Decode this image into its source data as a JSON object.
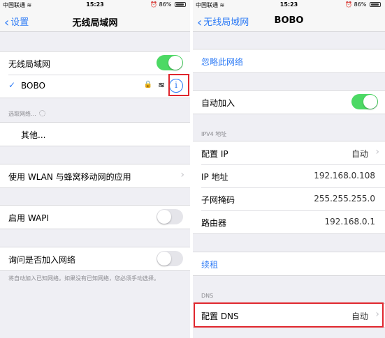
{
  "status": {
    "carrier": "中国联通",
    "time": "15:23",
    "battery": "86%"
  },
  "left": {
    "nav": {
      "back": "设置",
      "title": "无线局域网"
    },
    "wlan_label": "无线局域网",
    "network_name": "BOBO",
    "choose_network": "选取网络...",
    "other": "其他...",
    "apps": "使用 WLAN 与蜂窝移动网的应用",
    "wapi": "启用 WAPI",
    "ask_join": "询问是否加入网络",
    "footnote": "将自动加入已知网络。如果没有已知网络，您必须手动选择。"
  },
  "right": {
    "nav": {
      "back": "无线局域网",
      "title": "BOBO"
    },
    "forget": "忽略此网络",
    "auto_join": "自动加入",
    "ipv4_header": "IPV4 地址",
    "ipv4": [
      {
        "label": "配置 IP",
        "value": "自动"
      },
      {
        "label": "IP 地址",
        "value": "192.168.0.108"
      },
      {
        "label": "子网掩码",
        "value": "255.255.255.0"
      },
      {
        "label": "路由器",
        "value": "192.168.0.1"
      }
    ],
    "renew": "续租",
    "dns_header": "DNS",
    "dns_label": "配置 DNS",
    "dns_value": "自动"
  },
  "colors": {
    "accent": "#2f7cf6",
    "switch_on": "#4cd964",
    "highlight": "#e0262d"
  },
  "icons": [
    "wifi-icon",
    "alarm-icon",
    "battery-icon",
    "lock-icon",
    "info-icon",
    "chevron-left-icon",
    "chevron-right-icon",
    "checkmark-icon",
    "spinner-icon"
  ]
}
